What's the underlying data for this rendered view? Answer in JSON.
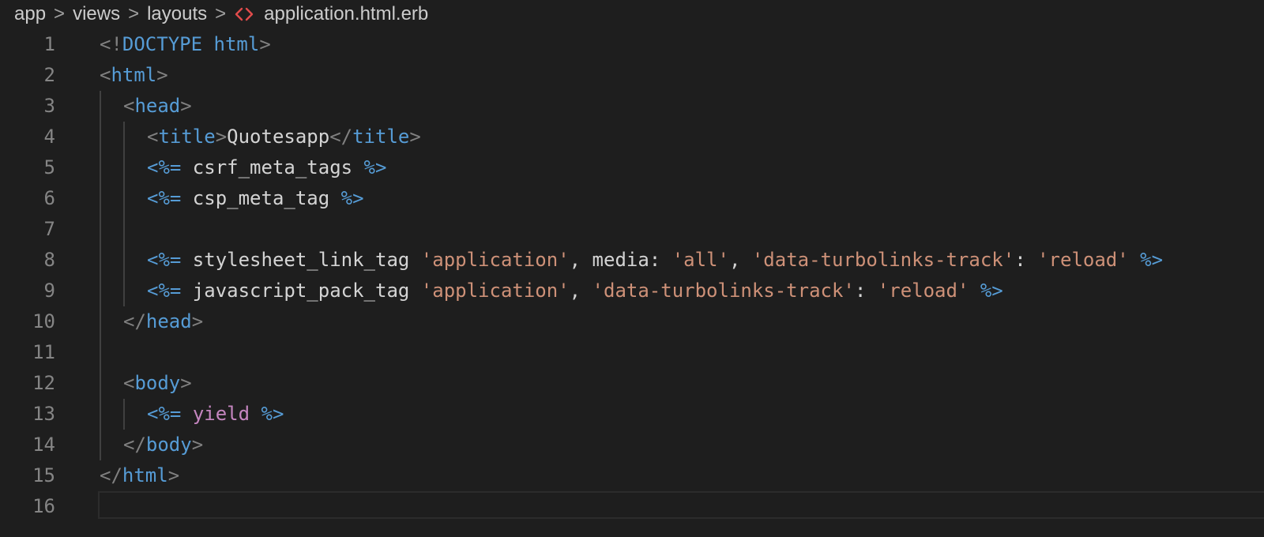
{
  "breadcrumb": {
    "items": [
      "app",
      "views",
      "layouts"
    ],
    "file": "application.html.erb",
    "separator": ">"
  },
  "editor": {
    "lines": [
      {
        "number": "1",
        "indent": 0,
        "tokens": [
          {
            "t": "<!",
            "c": "punc"
          },
          {
            "t": "DOCTYPE",
            "c": "tag"
          },
          {
            "t": " ",
            "c": "txt"
          },
          {
            "t": "html",
            "c": "tag"
          },
          {
            "t": ">",
            "c": "punc"
          }
        ]
      },
      {
        "number": "2",
        "indent": 0,
        "tokens": [
          {
            "t": "<",
            "c": "punc"
          },
          {
            "t": "html",
            "c": "tag"
          },
          {
            "t": ">",
            "c": "punc"
          }
        ]
      },
      {
        "number": "3",
        "indent": 1,
        "tokens": [
          {
            "t": "<",
            "c": "punc"
          },
          {
            "t": "head",
            "c": "tag"
          },
          {
            "t": ">",
            "c": "punc"
          }
        ]
      },
      {
        "number": "4",
        "indent": 2,
        "tokens": [
          {
            "t": "<",
            "c": "punc"
          },
          {
            "t": "title",
            "c": "tag"
          },
          {
            "t": ">",
            "c": "punc"
          },
          {
            "t": "Quotesapp",
            "c": "txt"
          },
          {
            "t": "</",
            "c": "punc"
          },
          {
            "t": "title",
            "c": "tag"
          },
          {
            "t": ">",
            "c": "punc"
          }
        ]
      },
      {
        "number": "5",
        "indent": 2,
        "tokens": [
          {
            "t": "<%=",
            "c": "erb"
          },
          {
            "t": " csrf_meta_tags ",
            "c": "txt"
          },
          {
            "t": "%>",
            "c": "erb"
          }
        ]
      },
      {
        "number": "6",
        "indent": 2,
        "tokens": [
          {
            "t": "<%=",
            "c": "erb"
          },
          {
            "t": " csp_meta_tag ",
            "c": "txt"
          },
          {
            "t": "%>",
            "c": "erb"
          }
        ]
      },
      {
        "number": "7",
        "indent": 2,
        "tokens": []
      },
      {
        "number": "8",
        "indent": 2,
        "tokens": [
          {
            "t": "<%=",
            "c": "erb"
          },
          {
            "t": " stylesheet_link_tag ",
            "c": "txt"
          },
          {
            "t": "'application'",
            "c": "str"
          },
          {
            "t": ", media: ",
            "c": "txt"
          },
          {
            "t": "'all'",
            "c": "str"
          },
          {
            "t": ", ",
            "c": "txt"
          },
          {
            "t": "'data-turbolinks-track'",
            "c": "str"
          },
          {
            "t": ": ",
            "c": "txt"
          },
          {
            "t": "'reload'",
            "c": "str"
          },
          {
            "t": " ",
            "c": "txt"
          },
          {
            "t": "%>",
            "c": "erb"
          }
        ]
      },
      {
        "number": "9",
        "indent": 2,
        "tokens": [
          {
            "t": "<%=",
            "c": "erb"
          },
          {
            "t": " javascript_pack_tag ",
            "c": "txt"
          },
          {
            "t": "'application'",
            "c": "str"
          },
          {
            "t": ", ",
            "c": "txt"
          },
          {
            "t": "'data-turbolinks-track'",
            "c": "str"
          },
          {
            "t": ": ",
            "c": "txt"
          },
          {
            "t": "'reload'",
            "c": "str"
          },
          {
            "t": " ",
            "c": "txt"
          },
          {
            "t": "%>",
            "c": "erb"
          }
        ]
      },
      {
        "number": "10",
        "indent": 1,
        "tokens": [
          {
            "t": "</",
            "c": "punc"
          },
          {
            "t": "head",
            "c": "tag"
          },
          {
            "t": ">",
            "c": "punc"
          }
        ]
      },
      {
        "number": "11",
        "indent": 1,
        "tokens": []
      },
      {
        "number": "12",
        "indent": 1,
        "tokens": [
          {
            "t": "<",
            "c": "punc"
          },
          {
            "t": "body",
            "c": "tag"
          },
          {
            "t": ">",
            "c": "punc"
          }
        ]
      },
      {
        "number": "13",
        "indent": 2,
        "tokens": [
          {
            "t": "<%=",
            "c": "erb"
          },
          {
            "t": " ",
            "c": "txt"
          },
          {
            "t": "yield",
            "c": "kw"
          },
          {
            "t": " ",
            "c": "txt"
          },
          {
            "t": "%>",
            "c": "erb"
          }
        ]
      },
      {
        "number": "14",
        "indent": 1,
        "tokens": [
          {
            "t": "</",
            "c": "punc"
          },
          {
            "t": "body",
            "c": "tag"
          },
          {
            "t": ">",
            "c": "punc"
          }
        ]
      },
      {
        "number": "15",
        "indent": 0,
        "tokens": [
          {
            "t": "</",
            "c": "punc"
          },
          {
            "t": "html",
            "c": "tag"
          },
          {
            "t": ">",
            "c": "punc"
          }
        ]
      },
      {
        "number": "16",
        "indent": 0,
        "current": true,
        "tokens": []
      }
    ]
  },
  "colors": {
    "background": "#1e1e1e",
    "tag": "#569cd6",
    "punctuation": "#808080",
    "string": "#ce9178",
    "keyword": "#c586c0",
    "text": "#d4d4d4",
    "line_number": "#858585",
    "file_icon": "#e04b4b"
  },
  "icons": {
    "file": "code-file-icon"
  }
}
